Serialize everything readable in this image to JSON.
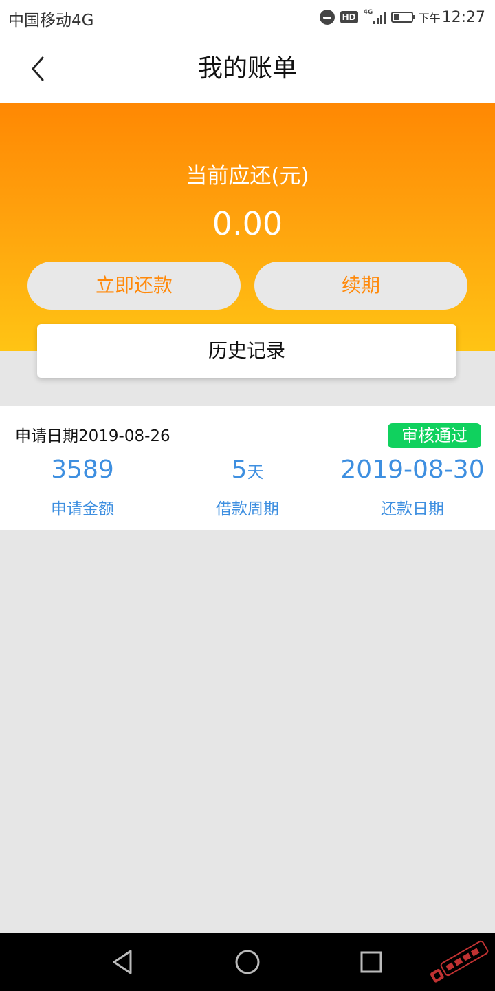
{
  "status_bar": {
    "carrier": "中国移动4G",
    "network_label": "4G",
    "hd_label": "HD",
    "time_period": "下午",
    "time": "12:27"
  },
  "header": {
    "title": "我的账单",
    "back_icon": "chevron-left-icon"
  },
  "summary": {
    "due_label": "当前应还(元)",
    "due_amount": "0.00",
    "repay_button": "立即还款",
    "renew_button": "续期",
    "history_button": "历史记录"
  },
  "record": {
    "apply_date_label": "申请日期2019-08-26",
    "status": "审核通过",
    "amount_value": "3589",
    "amount_label": "申请金额",
    "period_value": "5",
    "period_unit": "天",
    "period_label": "借款周期",
    "repay_date_value": "2019-08-30",
    "repay_date_label": "还款日期"
  },
  "colors": {
    "banner_top": "#ff8803",
    "banner_bottom": "#ffc414",
    "accent_orange": "#ff8a0c",
    "value_blue": "#3e8fe0",
    "status_green": "#10d15e"
  },
  "nav_bar": {
    "icons": [
      "back-triangle-icon",
      "home-circle-icon",
      "recents-square-icon"
    ]
  }
}
